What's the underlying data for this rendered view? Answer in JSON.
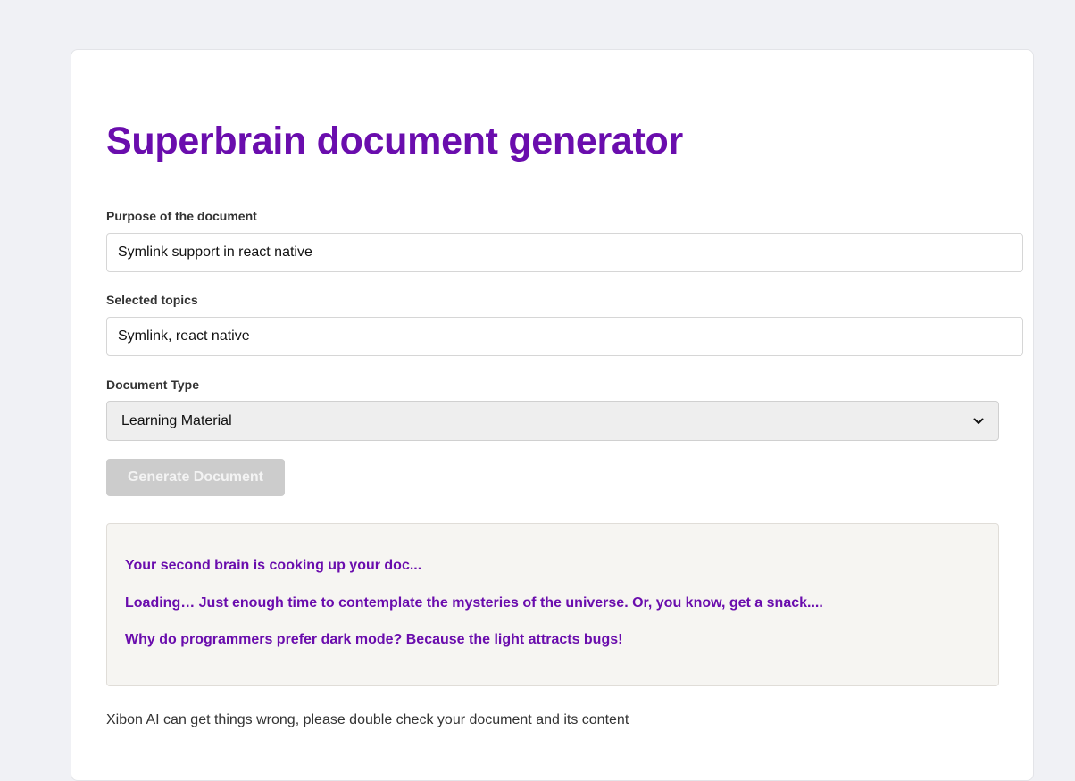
{
  "page": {
    "title": "Superbrain document generator"
  },
  "form": {
    "purpose": {
      "label": "Purpose of the document",
      "value": "Symlink support in react native"
    },
    "topics": {
      "label": "Selected topics",
      "value": "Symlink, react native"
    },
    "document_type": {
      "label": "Document Type",
      "selected": "Learning Material"
    },
    "generate_label": "Generate Document",
    "generate_enabled": false
  },
  "status": {
    "messages": [
      "Your second brain is cooking up your doc...",
      "Loading… Just enough time to contemplate the mysteries of the universe. Or, you know, get a snack....",
      "Why do programmers prefer dark mode? Because the light attracts bugs!"
    ]
  },
  "footer": {
    "disclaimer": "Xibon AI can get things wrong, please double check your document and its content"
  },
  "icons": {
    "select_arrow": "chevron-down-icon"
  },
  "colors": {
    "accent": "#6a0dad",
    "background": "#f0f1f5",
    "disabled_button": "#cccccc",
    "status_background": "#f6f5f2"
  }
}
